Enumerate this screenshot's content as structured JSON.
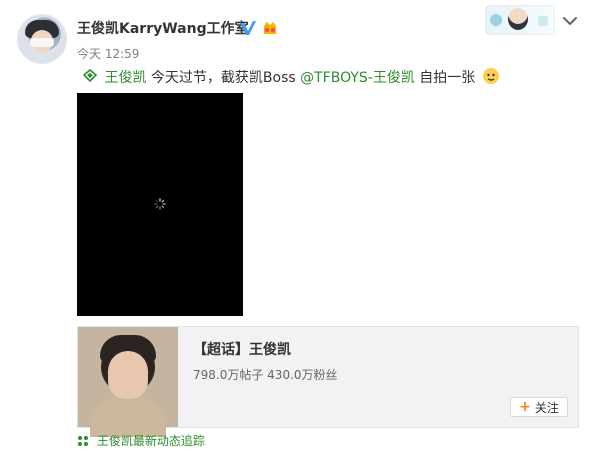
{
  "post": {
    "author": "王俊凯KarryWang工作室",
    "time": "今天 12:59",
    "content": {
      "tag": "王俊凯",
      "text_before_mention": " 今天过节，截获凯Boss",
      "mention": "@TFBOYS-王俊凯",
      "text_after_mention": " 自拍一张"
    }
  },
  "card": {
    "title": "【超话】王俊凯",
    "stats": "798.0万帖子 430.0万粉丝",
    "follow_label": "关注"
  },
  "footer": {
    "tracker_label": "王俊凯最新动态追踪"
  },
  "colors": {
    "link_green": "#2a8e2a",
    "accent_orange": "#ff8200",
    "verified_blue": "#3a9cf8"
  },
  "icons": [
    "verified-icon",
    "member-icon",
    "chevron-down-icon",
    "topic-tag-icon",
    "emoji-icon",
    "loading-spinner-icon",
    "plus-icon",
    "leaf-icon"
  ]
}
